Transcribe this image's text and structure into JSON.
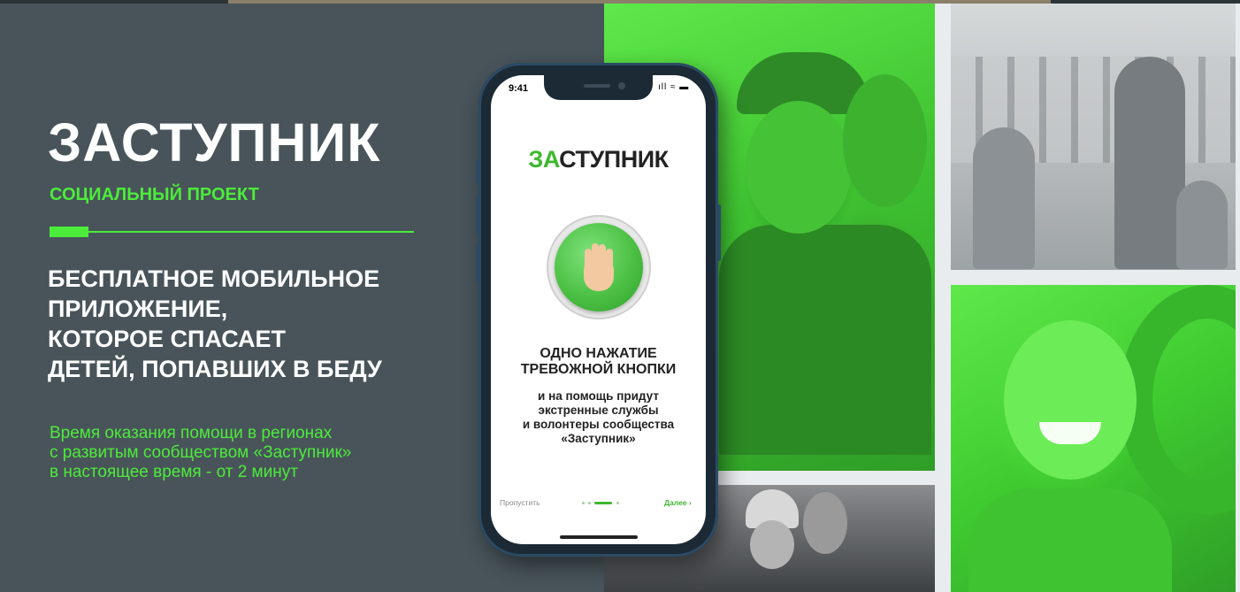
{
  "brand": {
    "title": "ЗАСТУПНИК",
    "subtitle": "СОЦИАЛЬНЫЙ ПРОЕКТ"
  },
  "headline": "БЕСПЛАТНОЕ МОБИЛЬНОЕ\nПРИЛОЖЕНИЕ,\nКОТОРОЕ СПАСАЕТ\nДЕТЕЙ, ПОПАВШИХ В БЕДУ",
  "info": "Время оказания помощи в регионах\nс развитым сообществом «Заступник»\nв настоящее время - от 2 минут",
  "phone": {
    "status_time": "9:41",
    "status_icons": "ıll ≈ ▬",
    "logo_accent": "ЗА",
    "logo_rest": "СТУПНИК",
    "headline": "ОДНО НАЖАТИЕ\nТРЕВОЖНОЙ КНОПКИ",
    "description": "и на помощь придут\nэкстренные службы\nи волонтеры сообщества\n«Заступник»",
    "skip_label": "Пропустить",
    "next_label": "Далее ›",
    "pager": {
      "total": 4,
      "current": 3
    }
  },
  "colors": {
    "accent": "#4cec3a",
    "panel_bg": "#48545a",
    "app_green": "#3eb82e"
  },
  "icons": [
    "raised-hand-icon",
    "signal-icon",
    "wifi-icon",
    "battery-icon"
  ]
}
